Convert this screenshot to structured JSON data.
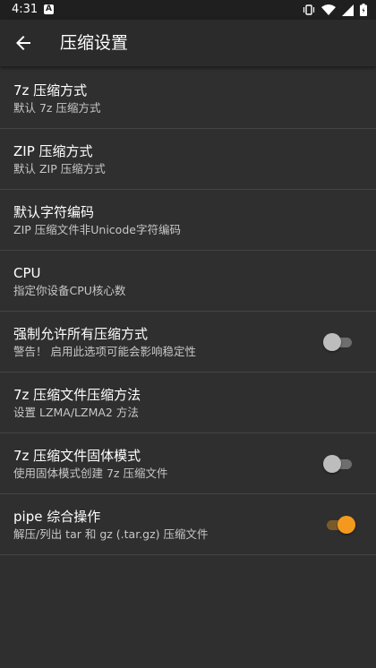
{
  "status_bar": {
    "time": "4:31",
    "notification_badge": "A",
    "icons": [
      "vibrate-icon",
      "wifi-icon",
      "signal-icon",
      "battery-icon"
    ]
  },
  "app_bar": {
    "title": "压缩设置",
    "back_icon": "arrow-back-icon"
  },
  "settings": [
    {
      "title": "7z 压缩方式",
      "subtitle": "默认 7z 压缩方式"
    },
    {
      "title": "ZIP 压缩方式",
      "subtitle": "默认 ZIP 压缩方式"
    },
    {
      "title": "默认字符编码",
      "subtitle": "ZIP 压缩文件非Unicode字符编码"
    },
    {
      "title": "CPU",
      "subtitle": "指定你设备CPU核心数"
    },
    {
      "title": "强制允许所有压缩方式",
      "subtitle": "警告！ 启用此选项可能会影响稳定性",
      "toggle": "off"
    },
    {
      "title": "7z 压缩文件压缩方法",
      "subtitle": "设置 LZMA/LZMA2 方法"
    },
    {
      "title": "7z 压缩文件固体模式",
      "subtitle": "使用固体模式创建 7z 压缩文件",
      "toggle": "off"
    },
    {
      "title": "pipe 综合操作",
      "subtitle": "解压/列出 tar 和 gz (.tar.gz) 压缩文件",
      "toggle": "on"
    }
  ],
  "colors": {
    "accent": "#f39a1e",
    "background": "#2f2f2f",
    "divider": "#444444"
  }
}
